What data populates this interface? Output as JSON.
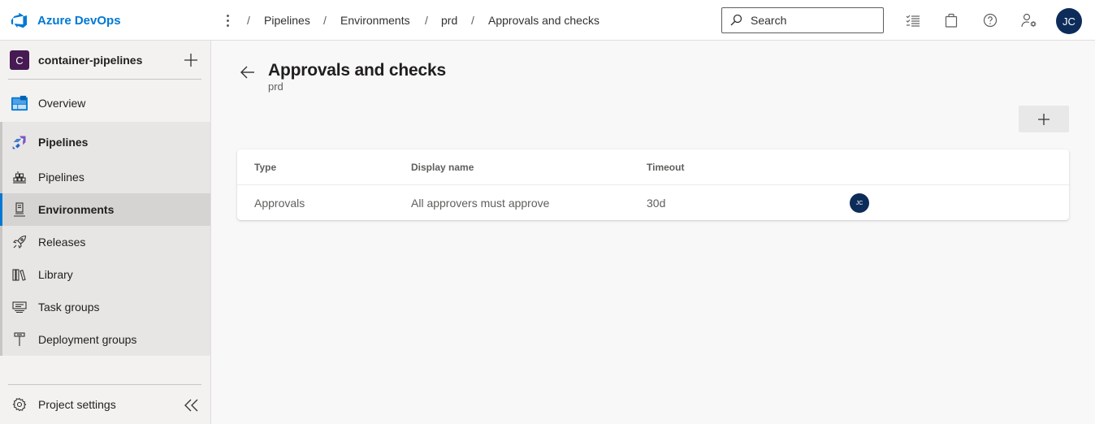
{
  "app": {
    "name": "Azure DevOps",
    "brand_color": "#0078d4"
  },
  "breadcrumb": [
    "Pipelines",
    "Environments",
    "prd",
    "Approvals and checks"
  ],
  "search": {
    "placeholder": "Search"
  },
  "user": {
    "initials": "JC"
  },
  "sidebar": {
    "project": {
      "initial": "C",
      "name": "container-pipelines"
    },
    "overview": "Overview",
    "section": "Pipelines",
    "items": [
      {
        "label": "Pipelines",
        "icon": "pipelines-icon"
      },
      {
        "label": "Environments",
        "icon": "environments-icon",
        "selected": true
      },
      {
        "label": "Releases",
        "icon": "rocket-icon"
      },
      {
        "label": "Library",
        "icon": "library-icon"
      },
      {
        "label": "Task groups",
        "icon": "task-groups-icon"
      },
      {
        "label": "Deployment groups",
        "icon": "deployment-groups-icon"
      }
    ],
    "settings": "Project settings"
  },
  "page": {
    "title": "Approvals and checks",
    "subtitle": "prd"
  },
  "table": {
    "headers": [
      "Type",
      "Display name",
      "Timeout"
    ],
    "rows": [
      {
        "type": "Approvals",
        "display_name": "All approvers must approve",
        "timeout": "30d",
        "approver_initials": "JC"
      }
    ]
  }
}
